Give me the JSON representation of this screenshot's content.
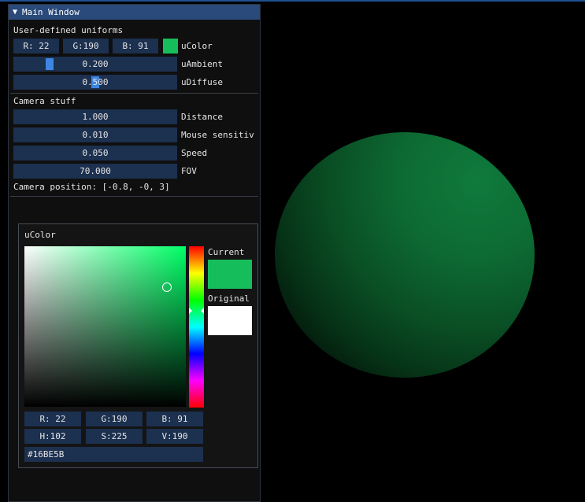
{
  "window": {
    "title": "Main Window",
    "collapse_arrow": "▼"
  },
  "uniforms": {
    "section_label": "User-defined uniforms",
    "color_r": "R: 22",
    "color_g": "G:190",
    "color_b": "B: 91",
    "color_label": "uColor",
    "color_hex": "#16BE5B",
    "ambient_value": "0.200",
    "ambient_label": "uAmbient",
    "diffuse_value": "0.500",
    "diffuse_label": "uDiffuse"
  },
  "camera": {
    "section_label": "Camera stuff",
    "distance_value": "1.000",
    "distance_label": "Distance",
    "mouse_value": "0.010",
    "mouse_label": "Mouse sensitiv",
    "speed_value": "0.050",
    "speed_label": "Speed",
    "fov_value": "70.000",
    "fov_label": "FOV",
    "position_text": "Camera position: [-0.8, -0, 3]"
  },
  "picker": {
    "title": "uColor",
    "current_label": "Current",
    "original_label": "Original",
    "current_color": "#16BE5B",
    "original_color": "#FFFFFF",
    "r": "R: 22",
    "g": "G:190",
    "b": "B: 91",
    "h": "H:102",
    "s": "S:225",
    "v": "V:190",
    "hex": "#16BE5B"
  },
  "accent_colors": {
    "titlebar": "#294A7A",
    "frame": "#1C304F",
    "slider_grab": "#3D85E0"
  }
}
